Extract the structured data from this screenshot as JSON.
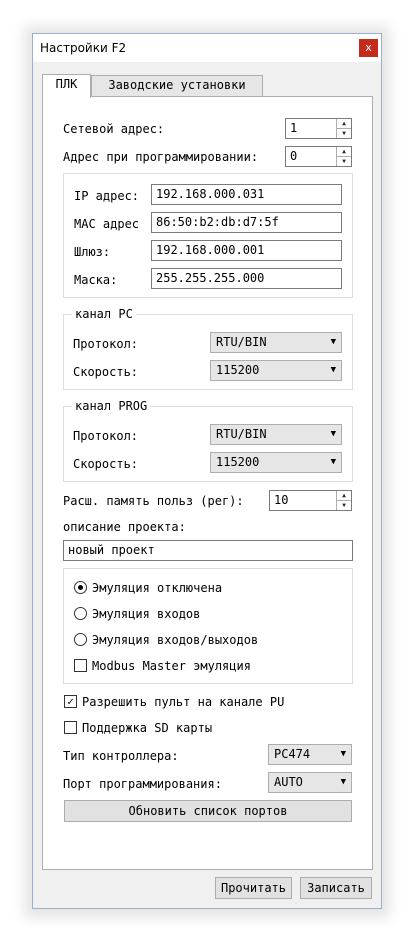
{
  "window": {
    "title": "Настройки F2",
    "close_label": "x"
  },
  "tabs": [
    {
      "label": "ПЛК"
    },
    {
      "label": "Заводские установки"
    }
  ],
  "plc": {
    "network_address": {
      "label": "Сетевой адрес:",
      "value": "1"
    },
    "prog_address": {
      "label": "Адрес при программировании:",
      "value": "0"
    },
    "ip": {
      "label": "IP адрес:",
      "value": "192.168.000.031"
    },
    "mac": {
      "label": "MAC адрес",
      "value": "86:50:b2:db:d7:5f"
    },
    "gateway": {
      "label": "Шлюз:",
      "value": "192.168.000.001"
    },
    "mask": {
      "label": "Маска:",
      "value": "255.255.255.000"
    }
  },
  "channel_pc": {
    "title": "канал PC",
    "protocol_label": "Протокол:",
    "protocol_value": "RTU/BIN",
    "speed_label": "Скорость:",
    "speed_value": "115200"
  },
  "channel_prog": {
    "title": "канал PROG",
    "protocol_label": "Протокол:",
    "protocol_value": "RTU/BIN",
    "speed_label": "Скорость:",
    "speed_value": "115200"
  },
  "ext_memory": {
    "label": "Расш. память польз (рег):",
    "value": "10"
  },
  "project": {
    "label": "описание проекта:",
    "value": "новый проект"
  },
  "emulation": {
    "options": [
      {
        "label": "Эмуляция отключена",
        "selected": true
      },
      {
        "label": "Эмуляция входов",
        "selected": false
      },
      {
        "label": "Эмуляция входов/выходов",
        "selected": false
      }
    ],
    "modbus_master_label": "Modbus Master эмуляция",
    "modbus_master_checked": false
  },
  "options": {
    "allow_pu_label": "Разрешить пульт на канале PU",
    "allow_pu_checked": true,
    "sd_card_label": "Поддержка SD карты",
    "sd_card_checked": false
  },
  "controller_type": {
    "label": "Тип контроллера:",
    "value": "PC474"
  },
  "prog_port": {
    "label": "Порт программирования:",
    "value": "AUTO"
  },
  "refresh_ports_label": "Обновить список портов",
  "footer": {
    "read_label": "Прочитать",
    "write_label": "Записать"
  },
  "check_glyph": "✓"
}
